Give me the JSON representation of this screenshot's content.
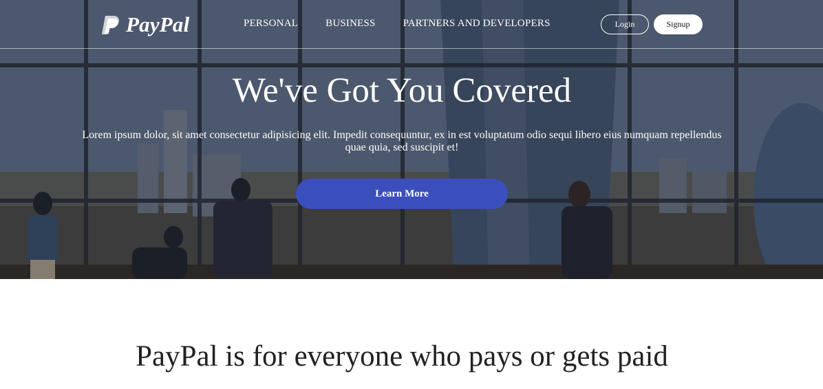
{
  "brand": {
    "name": "PayPal",
    "icon": "paypal-p-icon"
  },
  "nav": {
    "links": [
      "PERSONAL",
      "BUSINESS",
      "PARTNERS AND DEVELOPERS"
    ],
    "login_label": "Login",
    "signup_label": "Signup"
  },
  "hero": {
    "title": "We've Got You Covered",
    "text": "Lorem ipsum dolor, sit amet consectetur adipisicing elit. Impedit consequuntur, ex in est voluptatum odio sequi libero eius numquam repellendus quae quia, sed suscipit et!",
    "cta_label": "Learn More"
  },
  "section": {
    "title": "PayPal is for everyone who pays or gets paid"
  },
  "colors": {
    "accent": "#3b4fbc",
    "text_dark": "#222222",
    "white": "#ffffff"
  }
}
